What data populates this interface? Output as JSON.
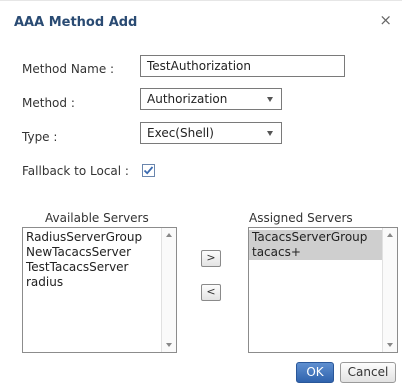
{
  "dialog": {
    "title": "AAA Method Add",
    "close_glyph": "×"
  },
  "form": {
    "method_name_label": "Method Name :",
    "method_name_value": "TestAuthorization",
    "method_label": "Method :",
    "method_value": "Authorization",
    "type_label": "Type :",
    "type_value": "Exec(Shell)",
    "fallback_label": "Fallback to Local :",
    "fallback_checked": true
  },
  "available": {
    "title": "Available Servers",
    "items": [
      "RadiusServerGroup",
      "NewTacacsServer",
      "TestTacacsServer",
      "radius"
    ]
  },
  "assigned": {
    "title": "Assigned Servers",
    "items": [
      "TacacsServerGroup",
      "tacacs+"
    ],
    "selected": [
      0,
      1
    ]
  },
  "transfer": {
    "add_label": ">",
    "remove_label": "<"
  },
  "buttons": {
    "ok_label": "OK",
    "cancel_label": "Cancel"
  },
  "colors": {
    "title": "#2a4b73",
    "ok_button": "#3a6fb8",
    "selection": "#cfcfcf",
    "checkbox_check": "#3b6bb0"
  },
  "icons": {
    "close": "close-icon",
    "dropdown": "chevron-down-icon",
    "check": "check-icon"
  }
}
